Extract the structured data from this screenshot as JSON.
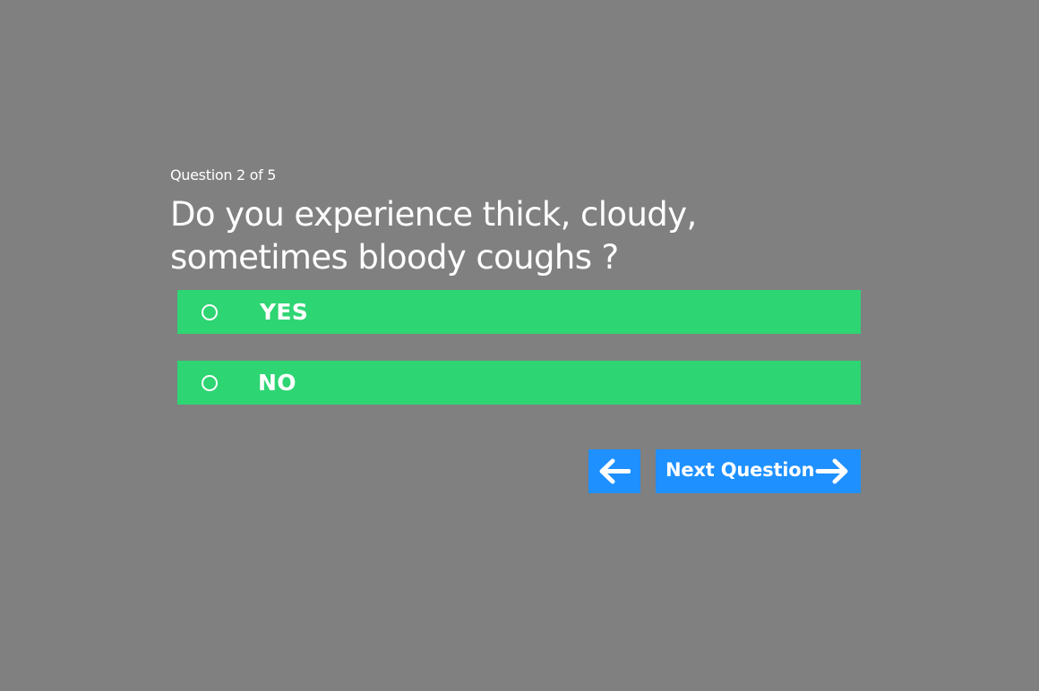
{
  "quiz": {
    "progress": "Question 2 of 5",
    "question": "Do you experience thick, cloudy, sometimes bloody coughs ?",
    "options": [
      {
        "label": "YES",
        "selected": false
      },
      {
        "label": "NO",
        "selected": false
      }
    ],
    "next_label": "Next Question",
    "back_icon": "arrow-left-icon",
    "next_icon": "arrow-right-icon"
  },
  "colors": {
    "background": "#808080",
    "option": "#2ed573",
    "button": "#1e90ff",
    "text": "#ffffff"
  }
}
